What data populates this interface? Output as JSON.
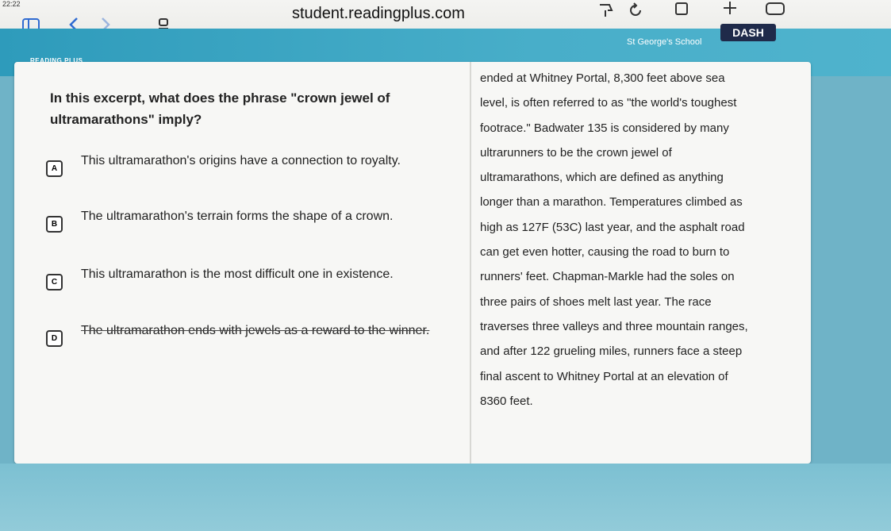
{
  "browser": {
    "time": "22:22",
    "url": "student.readingplus.com"
  },
  "header": {
    "logo_text": "READING PLUS",
    "school": "St George's School",
    "dash_label": "DASH"
  },
  "question": {
    "text": "In this excerpt, what does the phrase \"crown jewel of ultramarathons\" imply?"
  },
  "options": [
    {
      "letter": "A",
      "text": "This ultramarathon's origins have a connection to royalty.",
      "struck": false
    },
    {
      "letter": "B",
      "text": "The ultramarathon's terrain forms the shape of a crown.",
      "struck": false
    },
    {
      "letter": "C",
      "text": "This ultramarathon is the most difficult one in existence.",
      "struck": false
    },
    {
      "letter": "D",
      "text": "The ultramarathon ends with jewels as a reward to the winner.",
      "struck": true
    }
  ],
  "passage": {
    "lines": [
      "ended at Whitney Portal, 8,300 feet above sea",
      "level, is often referred to as \"the world's toughest",
      "footrace.\" Badwater 135 is considered by many",
      "ultrarunners to be the crown jewel of",
      "ultramarathons, which are defined as anything",
      "longer than a marathon. Temperatures climbed as",
      "high as 127F (53C) last year, and the asphalt road",
      "can get even hotter, causing the road to burn to",
      "runners' feet. Chapman-Markle had the soles on",
      "three pairs of shoes melt last year. The race",
      "traverses three valleys and three mountain ranges,",
      "and after 122 grueling miles, runners face a steep",
      "final ascent to Whitney Portal at an elevation of",
      "8360 feet."
    ]
  }
}
